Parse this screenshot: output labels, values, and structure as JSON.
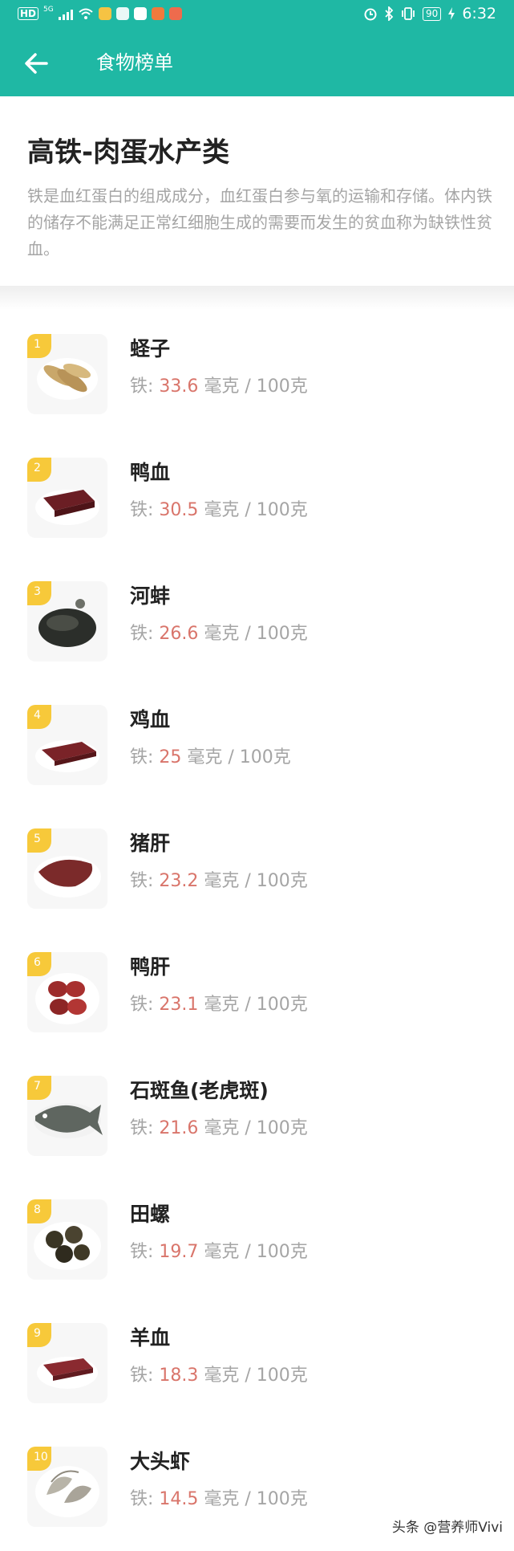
{
  "status_bar": {
    "left_hd": "HD",
    "left_net": "5G",
    "time": "6:32",
    "battery": "90"
  },
  "app_bar": {
    "title": "食物榜单"
  },
  "intro": {
    "title": "高铁-肉蛋水产类",
    "description": "铁是血红蛋白的组成成分，血红蛋白参与氧的运输和存储。体内铁的储存不能满足正常红细胞生成的需要而发生的贫血称为缺铁性贫血。"
  },
  "nutrient_label": "铁: ",
  "unit_label": " 毫克 / 100克",
  "items": [
    {
      "rank": "1",
      "name": "蛏子",
      "value": "33.6",
      "icon": "razor-clam-icon"
    },
    {
      "rank": "2",
      "name": "鸭血",
      "value": "30.5",
      "icon": "duck-blood-icon"
    },
    {
      "rank": "3",
      "name": "河蚌",
      "value": "26.6",
      "icon": "river-mussel-icon"
    },
    {
      "rank": "4",
      "name": "鸡血",
      "value": "25",
      "icon": "chicken-blood-icon"
    },
    {
      "rank": "5",
      "name": "猪肝",
      "value": "23.2",
      "icon": "pork-liver-icon"
    },
    {
      "rank": "6",
      "name": "鸭肝",
      "value": "23.1",
      "icon": "duck-liver-icon"
    },
    {
      "rank": "7",
      "name": "石斑鱼(老虎斑)",
      "value": "21.6",
      "icon": "grouper-fish-icon"
    },
    {
      "rank": "8",
      "name": "田螺",
      "value": "19.7",
      "icon": "field-snail-icon"
    },
    {
      "rank": "9",
      "name": "羊血",
      "value": "18.3",
      "icon": "lamb-blood-icon"
    },
    {
      "rank": "10",
      "name": "大头虾",
      "value": "14.5",
      "icon": "shrimp-icon"
    }
  ],
  "watermark": "头条 @营养师Vivi",
  "colors": {
    "header": "#1fb8a4",
    "rank_badge": "#f7c93a",
    "value_highlight": "#d9756b",
    "muted_text": "#a5a5a5"
  }
}
